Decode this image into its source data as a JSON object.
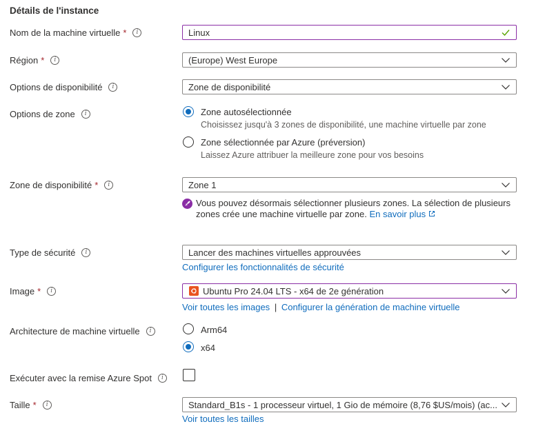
{
  "section": {
    "title": "Détails de l'instance"
  },
  "vm_name": {
    "label": "Nom de la machine virtuelle",
    "required": "*",
    "value": "Linux"
  },
  "region": {
    "label": "Région",
    "required": "*",
    "value": "(Europe) West Europe"
  },
  "availability_options": {
    "label": "Options de disponibilité",
    "value": "Zone de disponibilité"
  },
  "zone_options": {
    "label": "Options de zone",
    "options": [
      {
        "label": "Zone autosélectionnée",
        "description": "Choisissez jusqu'à 3 zones de disponibilité, une machine virtuelle par zone",
        "selected": true
      },
      {
        "label": "Zone sélectionnée par Azure (préversion)",
        "description": "Laissez Azure attribuer la meilleure zone pour vos besoins",
        "selected": false
      }
    ]
  },
  "availability_zone": {
    "label": "Zone de disponibilité",
    "required": "*",
    "value": "Zone 1",
    "note": "Vous pouvez désormais sélectionner plusieurs zones. La sélection de plusieurs zones crée une machine virtuelle par zone.",
    "note_link": "En savoir plus"
  },
  "security_type": {
    "label": "Type de sécurité",
    "value": "Lancer des machines virtuelles approuvées",
    "link": "Configurer les fonctionnalités de sécurité"
  },
  "image": {
    "label": "Image",
    "required": "*",
    "value": "Ubuntu Pro 24.04 LTS - x64 de 2e génération",
    "link_all": "Voir toutes les images",
    "separator": "|",
    "link_config": "Configurer la génération de machine virtuelle"
  },
  "architecture": {
    "label": "Architecture de machine virtuelle",
    "options": [
      {
        "label": "Arm64",
        "selected": false
      },
      {
        "label": "x64",
        "selected": true
      }
    ]
  },
  "spot": {
    "label": "Exécuter avec la remise Azure Spot",
    "checked": false
  },
  "size": {
    "label": "Taille",
    "required": "*",
    "value": "Standard_B1s - 1 processeur virtuel, 1 Gio de mémoire (8,76 $US/mois) (ac...",
    "link": "Voir toutes les tailles"
  },
  "colors": {
    "accent": "#0f6cbd",
    "focus": "#8a2da5",
    "required": "#a4262c",
    "valid": "#57a300"
  },
  "icons": [
    "info-icon",
    "chevron-down-icon",
    "checkmark-icon",
    "rocket-icon",
    "external-link-icon",
    "ubuntu-icon"
  ]
}
